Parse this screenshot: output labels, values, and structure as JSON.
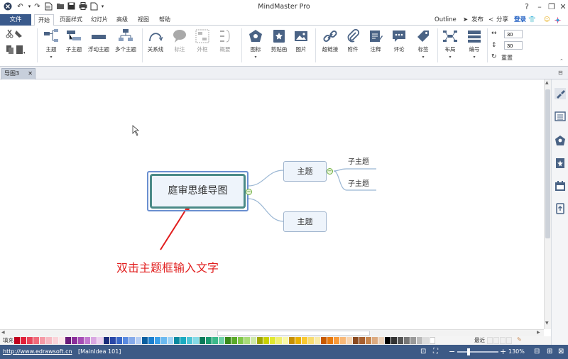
{
  "app": {
    "title": "MindMaster Pro"
  },
  "menu": {
    "file": "文件",
    "tabs": [
      "开始",
      "页面样式",
      "幻灯片",
      "高级",
      "视图",
      "帮助"
    ],
    "right": {
      "outline": "Outline",
      "publish": "发布",
      "share": "分享",
      "login": "登录"
    }
  },
  "ribbon": {
    "topic": "主题",
    "subtopic": "子主题",
    "floating": "浮动主题",
    "multi": "多个主题",
    "relation": "关系线",
    "callout": "标注",
    "boundary": "外框",
    "summary": "概要",
    "icon": "图标",
    "clipart": "剪贴画",
    "picture": "图片",
    "hyperlink": "超链接",
    "attachment": "附件",
    "note": "注释",
    "comment": "评论",
    "tag": "标签",
    "layout": "布局",
    "numbering": "编号",
    "width1": "30",
    "width2": "30",
    "reset": "重置"
  },
  "doc": {
    "tab": "导图3"
  },
  "map": {
    "main": "庭审思维导图",
    "topic1": "主题",
    "topic2": "主题",
    "sub1": "子主题",
    "sub2": "子主题",
    "annotation": "双击主题框输入文字"
  },
  "palette": {
    "fill_label": "填充",
    "recent_label": "最近",
    "colors": [
      "#c0001e",
      "#e0203a",
      "#e8455a",
      "#f06a7a",
      "#f59aa6",
      "#f7b9c2",
      "#fad3d9",
      "#fce6ea",
      "#6a1b7a",
      "#8a2f9a",
      "#a64db6",
      "#c27ad0",
      "#d9a7e2",
      "#ebcfef",
      "#1a2c7a",
      "#2a48a8",
      "#3a68c8",
      "#5a8ae0",
      "#86aaea",
      "#b5cdf3",
      "#0a5fa0",
      "#1a7fd0",
      "#3a9fe8",
      "#6ab9f0",
      "#9dd2f6",
      "#0a8aa0",
      "#1aaac0",
      "#4cc4d6",
      "#85dae6",
      "#0a7a5a",
      "#1a9a70",
      "#3ab88a",
      "#6dd0a6",
      "#3a8a1a",
      "#5aaa2a",
      "#80c84a",
      "#a8dc78",
      "#cce8a8",
      "#a0a800",
      "#c8d000",
      "#e0e830",
      "#f0f070",
      "#f8f8a8",
      "#c89000",
      "#e8b000",
      "#f8c830",
      "#f8dc70",
      "#f8eaa8",
      "#c85a00",
      "#e87a10",
      "#f89a3a",
      "#f8b878",
      "#f8d4b0",
      "#8a4a20",
      "#a86030",
      "#c8864e",
      "#dcaa80",
      "#ead0b8",
      "#000000",
      "#333333",
      "#555555",
      "#777777",
      "#999999",
      "#bbbbbb",
      "#dddddd",
      "#ffffff"
    ],
    "recent": [
      "#f0f0f0",
      "#f0f0f0",
      "#f0f0f0",
      "#f0f0f0"
    ]
  },
  "status": {
    "url": "http://www.edrawsoft.cn",
    "idea": "[MainIdea 101]",
    "zoom": "130%",
    "zoom_level": 0.28
  }
}
